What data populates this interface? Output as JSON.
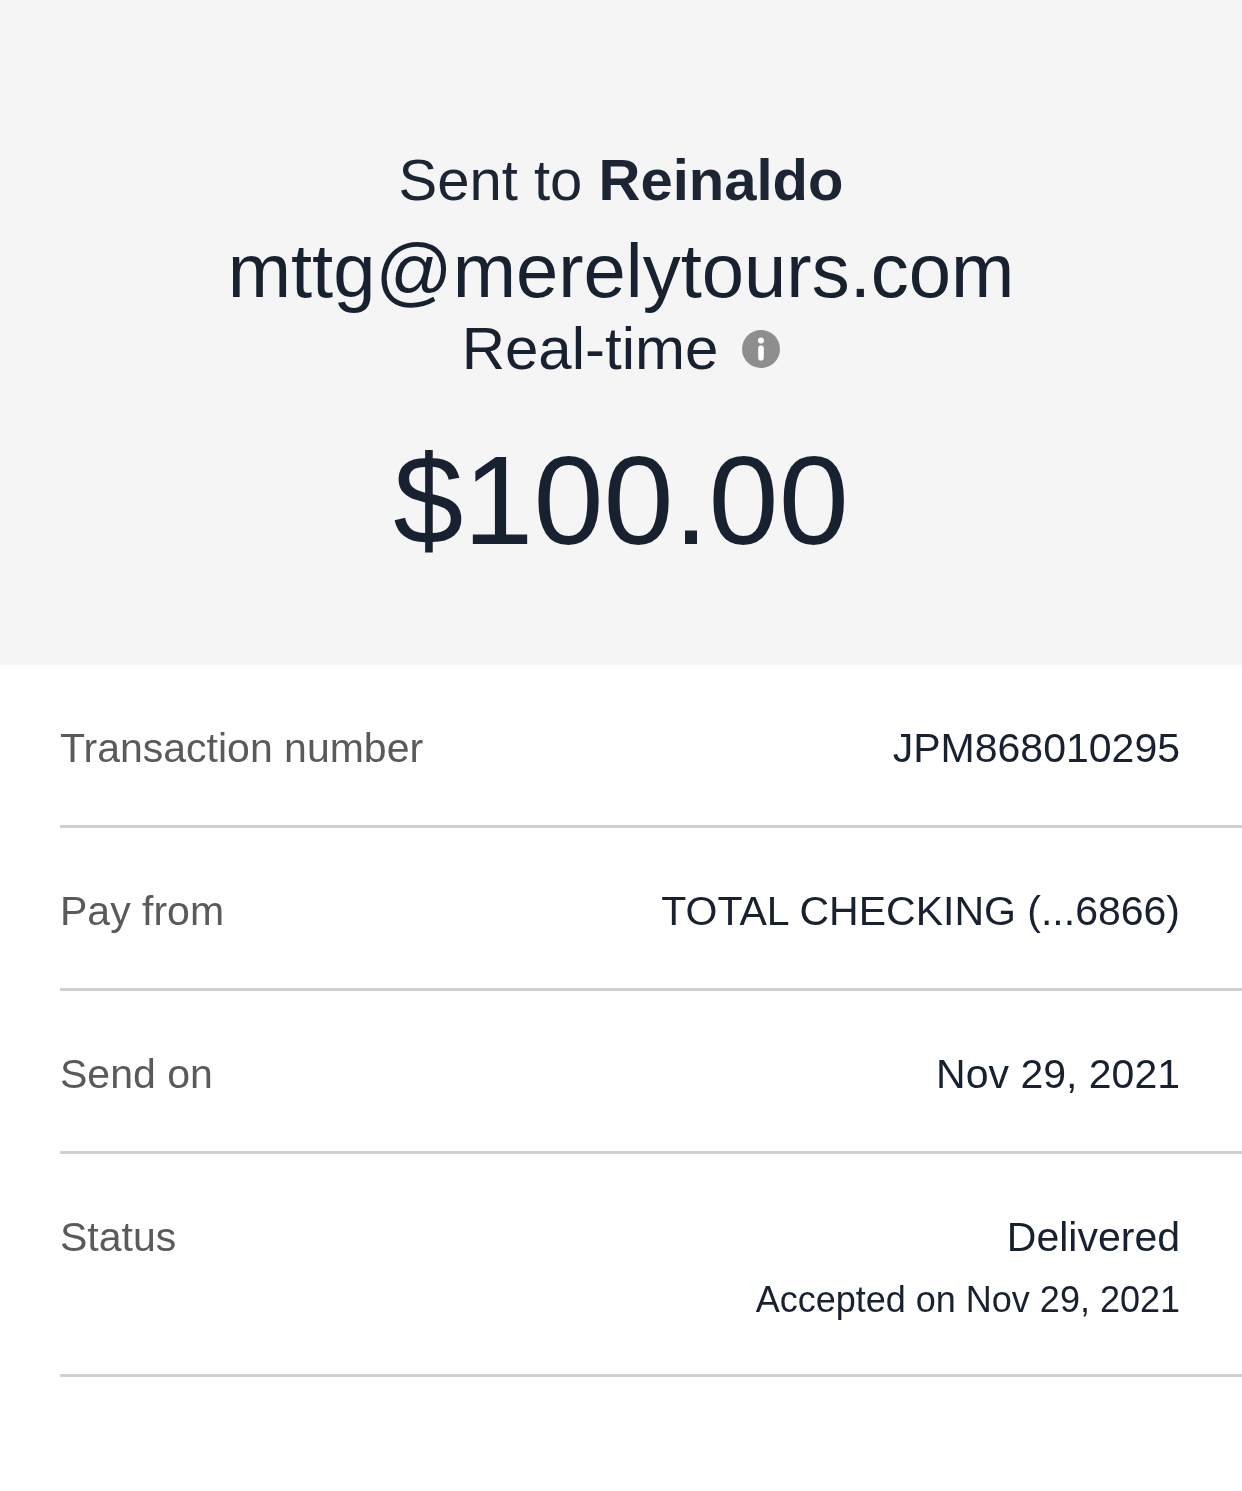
{
  "header": {
    "title": "Sent to **Reinaldo**",
    "email": "mttg@merelytours.com",
    "delivery": "Real-time",
    "amount": "$100.00"
  },
  "details": [
    {
      "label": "Transaction number",
      "value": "JPM868010295"
    },
    {
      "label": "Pay from",
      "value": "TOTAL CHECKING (...6866)"
    },
    {
      "label": "Send on",
      "value": "Nov 29, 2021"
    },
    {
      "label": "Status",
      "value": "Delivered",
      "note": "Accepted on Nov 29, 2021"
    }
  ]
}
